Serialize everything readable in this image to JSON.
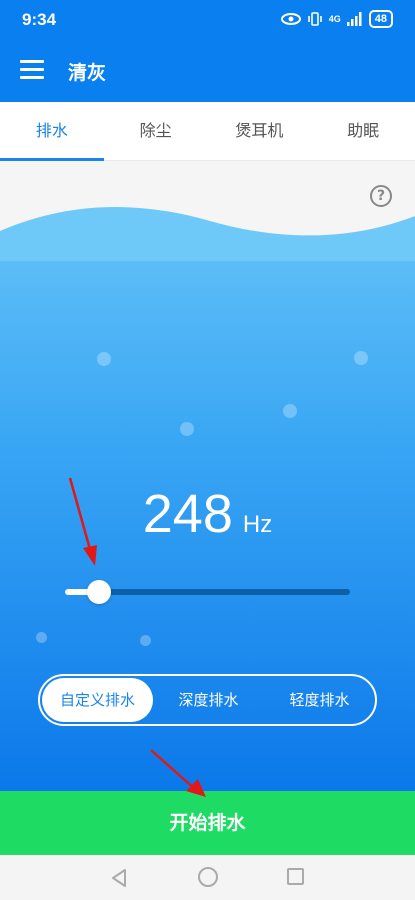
{
  "status_bar": {
    "time": "9:34",
    "network": "4G",
    "battery": "48"
  },
  "app_bar": {
    "title": "清灰"
  },
  "tabs": [
    {
      "label": "排水",
      "active": true
    },
    {
      "label": "除尘",
      "active": false
    },
    {
      "label": "煲耳机",
      "active": false
    },
    {
      "label": "助眠",
      "active": false
    }
  ],
  "help": {
    "label": "?"
  },
  "frequency": {
    "value": "248",
    "unit": "Hz"
  },
  "slider": {
    "fraction": 0.12
  },
  "modes": [
    {
      "label": "自定义排水",
      "active": true
    },
    {
      "label": "深度排水",
      "active": false
    },
    {
      "label": "轻度排水",
      "active": false
    }
  ],
  "start_button": {
    "label": "开始排水"
  },
  "colors": {
    "primary": "#0a7ff0",
    "accent": "#1a84ea",
    "start": "#1edb63",
    "arrow": "#e01818"
  },
  "icons": [
    "eye-icon",
    "vibrate-icon",
    "signal-icon",
    "battery-icon",
    "menu-icon",
    "help-icon",
    "back-icon",
    "home-icon",
    "recent-icon"
  ]
}
